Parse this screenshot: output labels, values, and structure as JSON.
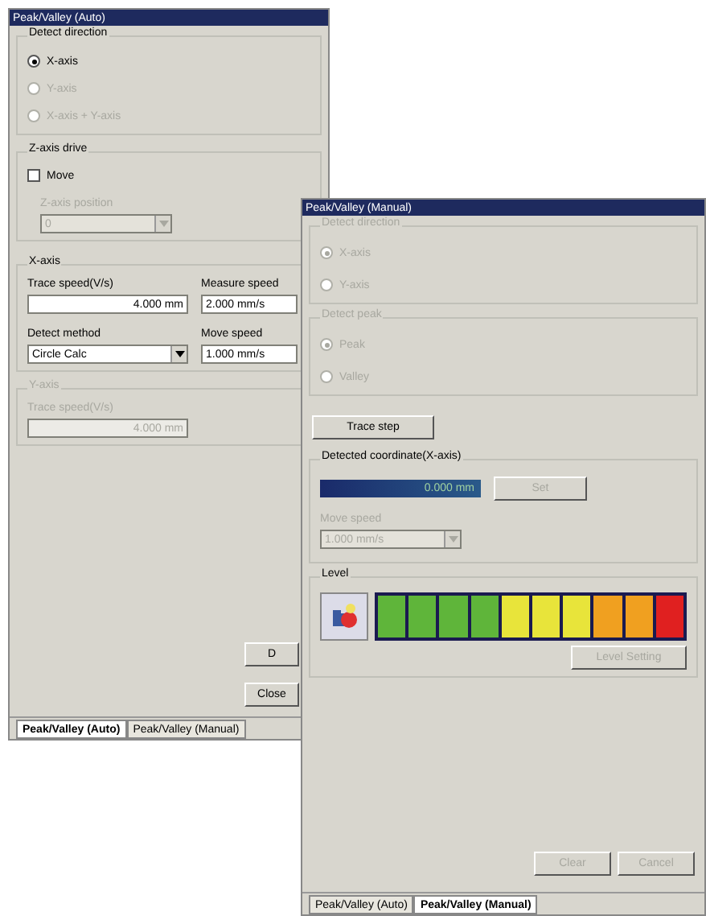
{
  "auto_window": {
    "title": "Peak/Valley (Auto)",
    "detect_direction": {
      "label": "Detect direction",
      "options": [
        {
          "label": "X-axis",
          "selected": true,
          "disabled": false
        },
        {
          "label": "Y-axis",
          "selected": false,
          "disabled": true
        },
        {
          "label": "X-axis + Y-axis",
          "selected": false,
          "disabled": true
        }
      ]
    },
    "z_axis_drive": {
      "label": "Z-axis drive",
      "move": {
        "label": "Move",
        "checked": false
      },
      "position_label": "Z-axis position",
      "position_value": "0",
      "position_disabled": true
    },
    "x_axis": {
      "label": "X-axis",
      "trace_speed_label": "Trace speed(V/s)",
      "trace_speed": "4.000 mm",
      "measure_speed_label": "Measure speed",
      "measure_speed": "2.000 mm/s",
      "detect_method_label": "Detect method",
      "detect_method": "Circle Calc",
      "move_speed_label": "Move speed",
      "move_speed": "1.000 mm/s"
    },
    "y_axis": {
      "label": "Y-axis",
      "disabled": true,
      "trace_speed_label": "Trace speed(V/s)",
      "trace_speed": "4.000 mm"
    },
    "buttons": [
      {
        "label": "D",
        "disabled": false
      },
      {
        "label": "Close",
        "disabled": false
      }
    ],
    "tabs": [
      {
        "label": "Peak/Valley (Auto)",
        "selected": true
      },
      {
        "label": "Peak/Valley (Manual)",
        "selected": false
      }
    ]
  },
  "manual_window": {
    "title": "Peak/Valley (Manual)",
    "groups": [
      {
        "label": "Detect direction",
        "disabled": true,
        "options": [
          {
            "label": "X-axis",
            "selected": true
          },
          {
            "label": "Y-axis",
            "selected": false
          }
        ]
      },
      {
        "label": "Detect peak",
        "disabled": true,
        "options": [
          {
            "label": "Peak",
            "selected": true
          },
          {
            "label": "Valley",
            "selected": false
          }
        ]
      }
    ],
    "trace_step": {
      "label": "Trace step",
      "disabled": false
    },
    "coordinate": {
      "label": "Detected coordinate(X-axis)",
      "value": "0.000 mm",
      "set": {
        "label": "Set",
        "disabled": true
      },
      "move_speed_label": "Move speed",
      "move_speed": "1.000 mm/s",
      "move_speed_disabled": true
    },
    "level": {
      "label": "Level",
      "segments": [
        {
          "color": "#5fb53a",
          "lit": true
        },
        {
          "color": "#5fb53a",
          "lit": true
        },
        {
          "color": "#5fb53a",
          "lit": true
        },
        {
          "color": "#5fb53a",
          "lit": true
        },
        {
          "color": "#e8e43a",
          "lit": true
        },
        {
          "color": "#e8e43a",
          "lit": true
        },
        {
          "color": "#e8e43a",
          "lit": true
        },
        {
          "color": "#f0a020",
          "lit": true
        },
        {
          "color": "#f0a020",
          "lit": true
        },
        {
          "color": "#e02020",
          "lit": true
        }
      ],
      "setting": {
        "label": "Level Setting",
        "disabled": true
      }
    },
    "buttons": [
      {
        "label": "Clear",
        "disabled": true
      },
      {
        "label": "Cancel",
        "disabled": true
      }
    ],
    "tabs": [
      {
        "label": "Peak/Valley (Auto)",
        "selected": false
      },
      {
        "label": "Peak/Valley (Manual)",
        "selected": true
      }
    ]
  }
}
